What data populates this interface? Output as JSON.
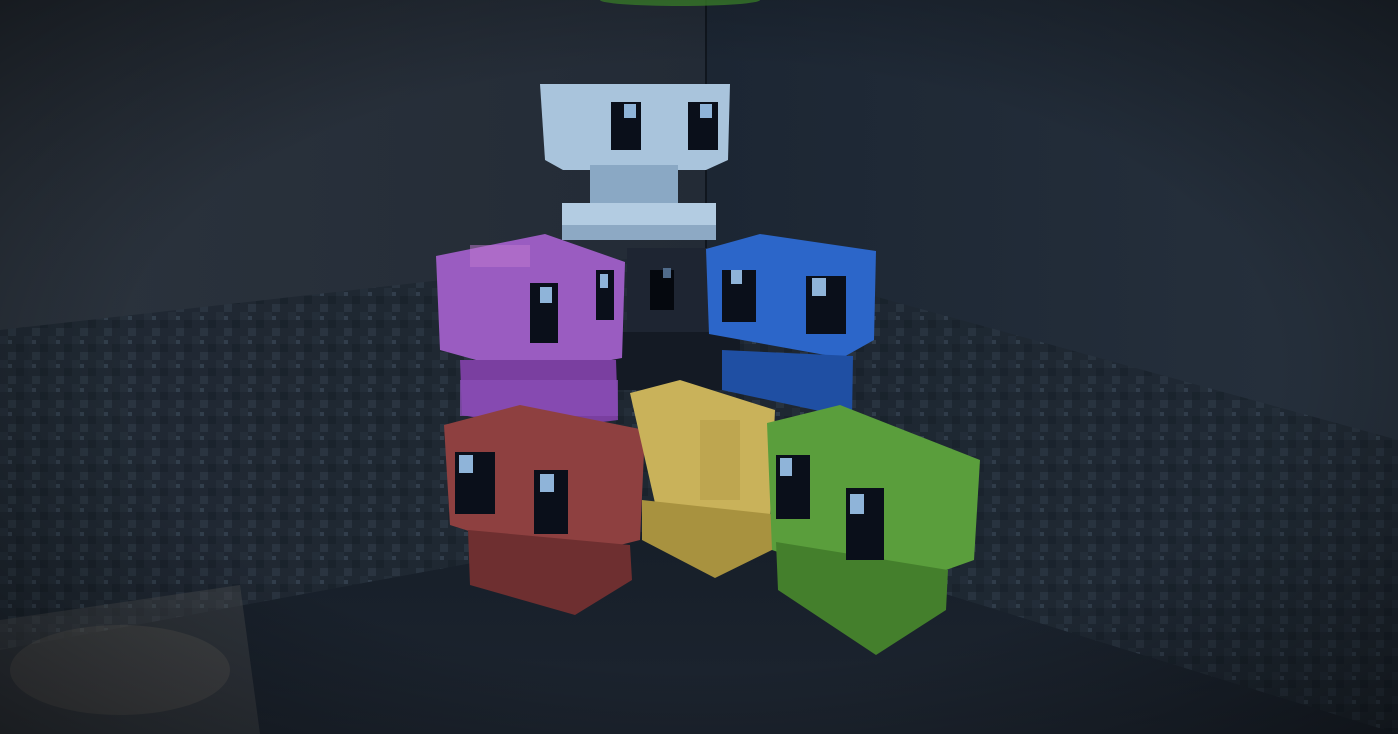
{
  "scene": {
    "kind": "voxel-game-screenshot",
    "hud_visible": false,
    "palette": {
      "wall": "#2a3340",
      "wall_lower": "#1c2530",
      "floor": "#1a222c",
      "light_patch": "#4a5058",
      "eye_dark": "#0a0f1a",
      "eye_glint": "#8fb4d9",
      "canopy_green": "#3f8a2e"
    },
    "figures": [
      {
        "name": "light-blue-figure",
        "color": "#a9c4dc",
        "shade": "#7f9cb8",
        "dark": "#5b7691"
      },
      {
        "name": "purple-figure",
        "color": "#9a5cc1",
        "shade": "#7a3fa0",
        "dark": "#52286e"
      },
      {
        "name": "black-figure",
        "color": "#1e2532",
        "shade": "#141a24",
        "dark": "#0b1018"
      },
      {
        "name": "blue-figure",
        "color": "#2c66c9",
        "shade": "#1f4fa3",
        "dark": "#163a7a"
      },
      {
        "name": "red-figure",
        "color": "#8e4040",
        "shade": "#6e2f30",
        "dark": "#4c1f22"
      },
      {
        "name": "yellow-figure",
        "color": "#c9b25a",
        "shade": "#a8923f",
        "dark": "#7a6a2c"
      },
      {
        "name": "green-figure",
        "color": "#5a9e3c",
        "shade": "#447f2c",
        "dark": "#2f5c1f"
      }
    ]
  }
}
